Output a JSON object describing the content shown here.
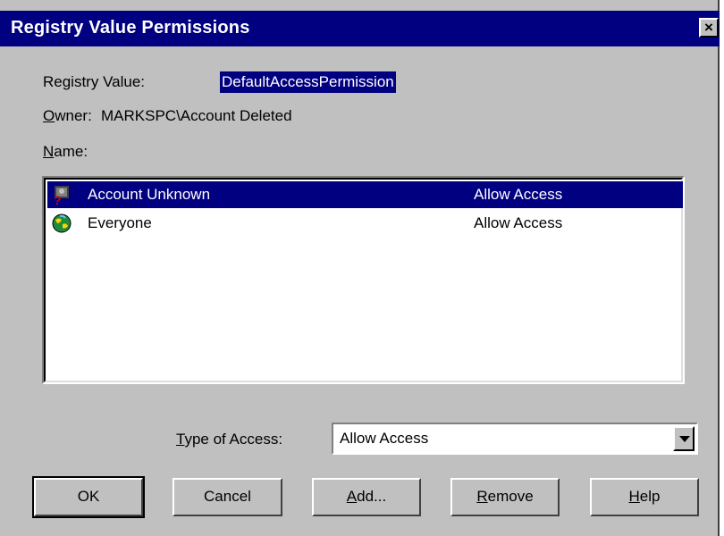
{
  "window": {
    "title": "Registry Value Permissions",
    "close_label": "×"
  },
  "registry_value": {
    "label": "Registry Value:",
    "value": "DefaultAccessPermission"
  },
  "owner": {
    "label_access_key": "O",
    "label_rest": "wner:",
    "value": "MARKSPC\\Account Deleted"
  },
  "name_label": {
    "access_key": "N",
    "rest": "ame:"
  },
  "list": {
    "rows": [
      {
        "name": "Account Unknown",
        "access": "Allow Access",
        "icon": "unknown-account-icon",
        "selected": true
      },
      {
        "name": "Everyone",
        "access": "Allow Access",
        "icon": "globe-icon",
        "selected": false
      }
    ]
  },
  "type_of_access": {
    "label_access_key": "T",
    "label_rest": "ype of Access:",
    "selected": "Allow Access"
  },
  "buttons": {
    "ok": {
      "key": "",
      "rest": "OK"
    },
    "cancel": {
      "key": "",
      "rest": "Cancel"
    },
    "add": {
      "key": "A",
      "rest": "dd..."
    },
    "remove": {
      "key": "R",
      "rest": "emove"
    },
    "help": {
      "key": "H",
      "rest": "elp"
    }
  },
  "colors": {
    "titlebar": "#000080",
    "face": "#c0c0c0",
    "selection": "#000080"
  }
}
